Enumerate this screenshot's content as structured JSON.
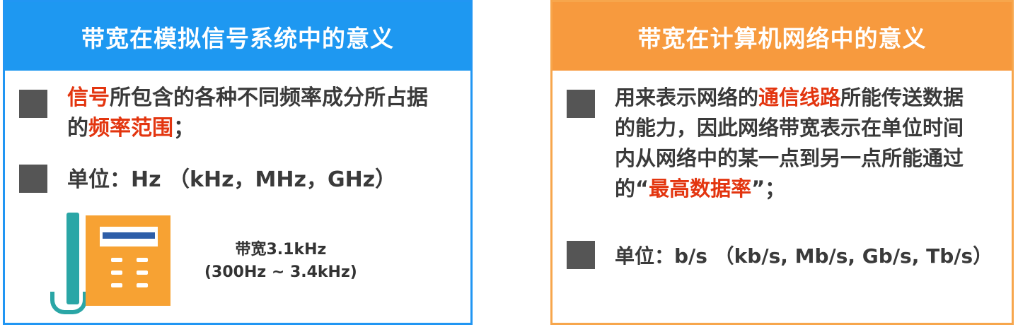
{
  "left_panel": {
    "title": "带宽在模拟信号系统中的意义",
    "item1": {
      "line1_red": "信号",
      "line1_rest": "所包含的各种不同频率成分所占据",
      "line2_pre": "的",
      "line2_red": "频率范围",
      "line2_post": "；"
    },
    "item2": "单位：Hz （kHz，MHz，GHz）",
    "bandwidth_label": "带宽3.1kHz",
    "bandwidth_range": "(300Hz ~ 3.4kHz)",
    "icon": "telephone-icon"
  },
  "right_panel": {
    "title": "带宽在计算机网络中的意义",
    "item1": {
      "line1_pre": "用来表示网络的",
      "line1_red": "通信线路",
      "line1_post": "所能传送数据",
      "line2": "的能力，因此网络带宽表示在单位时间",
      "line3": "内从网络中的某一点到另一点所能通过",
      "line4_pre": "的“",
      "line4_red": "最高数据率",
      "line4_post": "”；"
    },
    "item2": "单位：b/s （kb/s, Mb/s, Gb/s, Tb/s）"
  },
  "colors": {
    "left_header": "#1e98f1",
    "right_header": "#f79a3e",
    "highlight": "#e3350f",
    "bullet": "#555555"
  }
}
